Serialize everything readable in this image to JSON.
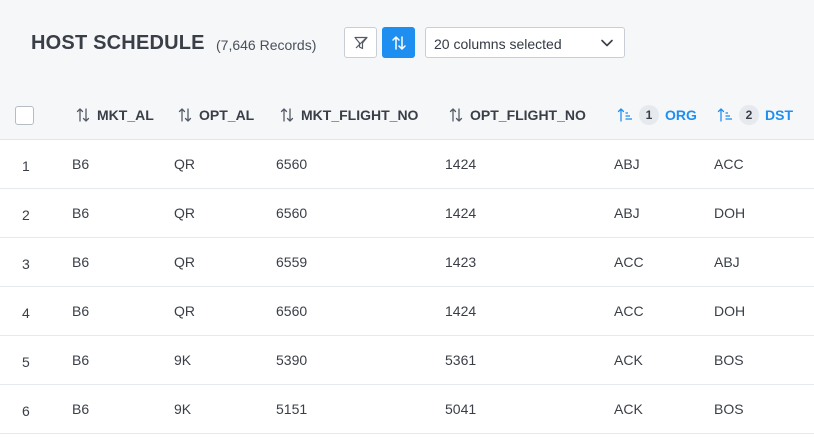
{
  "header": {
    "title": "HOST SCHEDULE",
    "record_count": "(7,646 Records)",
    "filter_icon": "filter-icon",
    "sort_icon": "sort-icon",
    "columns_select": {
      "value": "20 columns selected",
      "icon": "chevron-down-icon"
    }
  },
  "colors": {
    "accent": "#1e8ff0",
    "header_bg": "#f6f7f9",
    "text": "#3a3f47"
  },
  "table": {
    "columns": [
      {
        "label": "MKT_AL",
        "sort_icon": "sort-both-icon",
        "active": false
      },
      {
        "label": "OPT_AL",
        "sort_icon": "sort-both-icon",
        "active": false
      },
      {
        "label": "MKT_FLIGHT_NO",
        "sort_icon": "sort-both-icon",
        "active": false
      },
      {
        "label": "OPT_FLIGHT_NO",
        "sort_icon": "sort-both-icon",
        "active": false
      },
      {
        "label": "ORG",
        "sort_icon": "sort-ascending-icon",
        "active": true,
        "priority": "1"
      },
      {
        "label": "DST",
        "sort_icon": "sort-ascending-icon",
        "active": true,
        "priority": "2"
      }
    ],
    "rows": [
      {
        "num": "1",
        "cells": [
          "B6",
          "QR",
          "6560",
          "1424",
          "ABJ",
          "ACC"
        ]
      },
      {
        "num": "2",
        "cells": [
          "B6",
          "QR",
          "6560",
          "1424",
          "ABJ",
          "DOH"
        ]
      },
      {
        "num": "3",
        "cells": [
          "B6",
          "QR",
          "6559",
          "1423",
          "ACC",
          "ABJ"
        ]
      },
      {
        "num": "4",
        "cells": [
          "B6",
          "QR",
          "6560",
          "1424",
          "ACC",
          "DOH"
        ]
      },
      {
        "num": "5",
        "cells": [
          "B6",
          "9K",
          "5390",
          "5361",
          "ACK",
          "BOS"
        ]
      },
      {
        "num": "6",
        "cells": [
          "B6",
          "9K",
          "5151",
          "5041",
          "ACK",
          "BOS"
        ]
      }
    ]
  }
}
